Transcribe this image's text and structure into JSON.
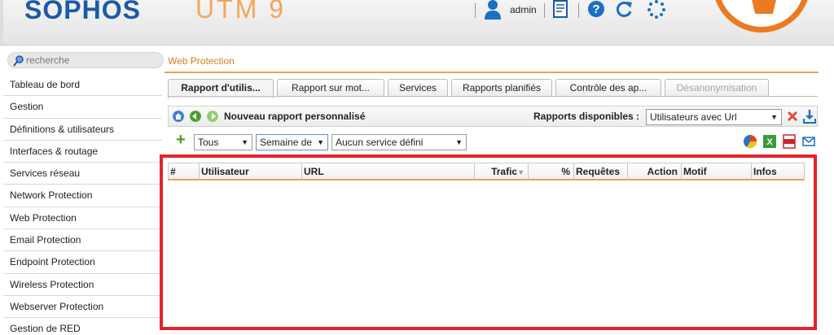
{
  "header": {
    "logo": "SOPHOS",
    "product": "UTM 9",
    "user": "admin",
    "icons": [
      "user-icon",
      "notes-icon",
      "help-icon",
      "refresh-icon",
      "loading-icon"
    ]
  },
  "sidebar": {
    "search_placeholder": "recherche",
    "items": [
      {
        "label": "Tableau de bord"
      },
      {
        "label": "Gestion"
      },
      {
        "label": "Définitions & utilisateurs"
      },
      {
        "label": "Interfaces & routage"
      },
      {
        "label": "Services réseau"
      },
      {
        "label": "Network Protection"
      },
      {
        "label": "Web Protection"
      },
      {
        "label": "Email Protection"
      },
      {
        "label": "Endpoint Protection"
      },
      {
        "label": "Wireless Protection"
      },
      {
        "label": "Webserver Protection"
      },
      {
        "label": "Gestion de RED"
      }
    ]
  },
  "breadcrumb": "Web Protection",
  "tabs": [
    {
      "label": "Rapport d'utilis...",
      "state": "active"
    },
    {
      "label": "Rapport sur mot...",
      "state": "normal"
    },
    {
      "label": "Services",
      "state": "normal"
    },
    {
      "label": "Rapports planifiés",
      "state": "normal"
    },
    {
      "label": "Contrôle des ap...",
      "state": "normal"
    },
    {
      "label": "Désanonymisation",
      "state": "disabled"
    }
  ],
  "toolbar": {
    "report_title": "Nouveau rapport personnalisé",
    "available_label": "Rapports disponibles :",
    "available_value": "Utilisateurs avec Url"
  },
  "filters": {
    "scope": "Tous",
    "period": "Semaine de",
    "service": "Aucun service défini"
  },
  "table": {
    "columns": [
      "#",
      "Utilisateur",
      "URL",
      "Trafic",
      "%",
      "Requêtes",
      "Action",
      "Motif",
      "Infos"
    ],
    "rows": []
  },
  "colors": {
    "accent_orange": "#ea7b22",
    "logo_blue": "#1c5aa6",
    "highlight_red": "#e3232a"
  }
}
